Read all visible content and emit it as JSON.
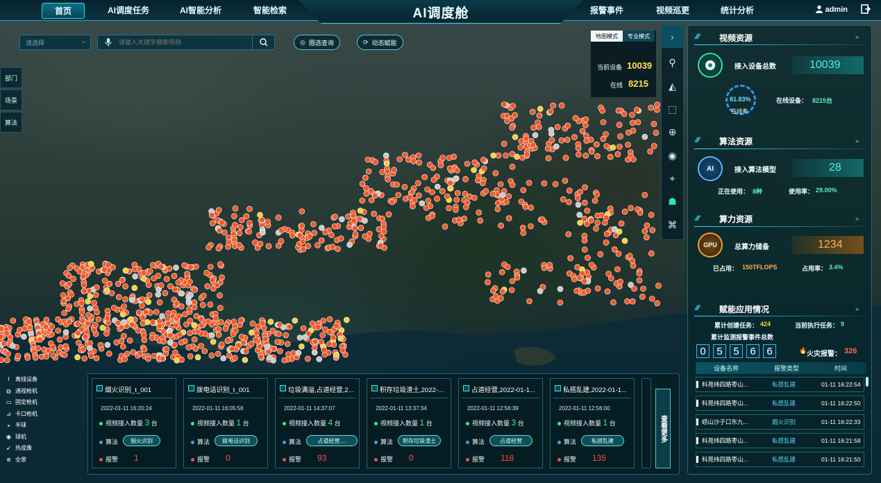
{
  "nav": {
    "home": "首页",
    "ai_task": "AI调度任务",
    "ai_analysis": "AI智能分析",
    "smart_search": "智能检索",
    "title": "AI调度舱",
    "alarm_event": "报警事件",
    "video_patrol": "视频巡更",
    "stats": "统计分析",
    "user": "admin"
  },
  "toolbar": {
    "select_placeholder": "请选择",
    "search_placeholder": "请输入关键字搜索视频",
    "circle_query": "圈选查询",
    "dynamic_assign": "动态赋能"
  },
  "left_nav": [
    "部门",
    "场景",
    "算法"
  ],
  "map_mode": {
    "map": "地图模式",
    "pro": "专业模式",
    "current_devices_label": "当前设备",
    "current_devices": "10039",
    "online_label": "在线",
    "online": "8215"
  },
  "video": {
    "section": "视频资源",
    "total_label": "接入设备总数",
    "total": "10039",
    "rate": "81.83%",
    "rate_label": "在线率",
    "online_label": "在线设备：",
    "online": "8215台"
  },
  "algo": {
    "section": "算法资源",
    "label": "接入算法模型",
    "value": "28",
    "using_label": "正在使用：",
    "using": "8种",
    "use_rate_label": "使用率：",
    "use_rate": "29.00%",
    "icon_text": "AI"
  },
  "compute": {
    "section": "算力资源",
    "label": "总算力储备",
    "value": "1234",
    "used_label": "已占用：",
    "used": "150TFLOPS",
    "occupy_label": "占用率：",
    "occupy": "3.4%",
    "icon_text": "GPU"
  },
  "empower": {
    "section": "赋能应用情况",
    "created_label": "累计创建任务：",
    "created": "424",
    "running_label": "当前执行任务：",
    "running": "9",
    "alarm_total_label": "累计监测报警事件总数",
    "digits": [
      "0",
      "5",
      "5",
      "6",
      "6"
    ],
    "fire_label": "火灾报警：",
    "fire": "326"
  },
  "table": {
    "headers": [
      "设备名称",
      "报警类型",
      "时间"
    ],
    "rows": [
      {
        "name": "科苑纬四路枣山...",
        "type": "私搭乱建",
        "time": "01-11 16:22:54"
      },
      {
        "name": "科苑纬四路枣山...",
        "type": "私搭乱建",
        "time": "01-11 16:22:50"
      },
      {
        "name": "崂山沙子口东九...",
        "type": "烟火识别",
        "time": "01-11 16:22:33"
      },
      {
        "name": "科苑纬四路枣山...",
        "type": "私搭乱建",
        "time": "01-11 16:21:58"
      },
      {
        "name": "科苑纬四路枣山...",
        "type": "私搭乱建",
        "time": "01-11 16:21:50"
      }
    ]
  },
  "legend": [
    "离线设备",
    "通视枪机",
    "固定枪机",
    "卡口枪机",
    "半球",
    "球机",
    "热成像",
    "全景"
  ],
  "cards": [
    {
      "title": "烟火识别_t_001",
      "time": "2022-01-11 16:20:24",
      "qty_label": "视频接入数量",
      "qty": "3",
      "unit": "台",
      "algo_label": "算法",
      "algo": "烟火识别",
      "alarm_label": "报警",
      "alarm": "1"
    },
    {
      "title": "拨电话识别_t_001",
      "time": "2022-01-11 16:05:56",
      "qty_label": "视频接入数量",
      "qty": "1",
      "unit": "台",
      "algo_label": "算法",
      "algo": "拨电话识别",
      "alarm_label": "报警",
      "alarm": "0"
    },
    {
      "title": "垃圾满溢,占道经营,2...",
      "time": "2022-01-11 14:37:07",
      "qty_label": "视频接入数量",
      "qty": "4",
      "unit": "台",
      "algo_label": "算法",
      "algo": "占道经营,...",
      "alarm_label": "报警",
      "alarm": "93"
    },
    {
      "title": "积存垃圾渣土,2022-...",
      "time": "2022-01-11 13:37:34",
      "qty_label": "视频接入数量",
      "qty": "1",
      "unit": "台",
      "algo_label": "算法",
      "algo": "积存垃圾渣土",
      "alarm_label": "报警",
      "alarm": "0"
    },
    {
      "title": "占道经营,2022-01-1...",
      "time": "2022-01-11 12:56:39",
      "qty_label": "视频接入数量",
      "qty": "3",
      "unit": "台",
      "algo_label": "算法",
      "algo": "占道经营",
      "alarm_label": "报警",
      "alarm": "118"
    },
    {
      "title": "私搭乱建,2022-01-1...",
      "time": "2022-01-11 12:56:00",
      "qty_label": "视频接入数量",
      "qty": "1",
      "unit": "台",
      "algo_label": "算法",
      "algo": "私搭乱建",
      "alarm_label": "报警",
      "alarm": "135"
    }
  ],
  "more": "查看更多",
  "colors": {
    "accent": "#2fe6ff",
    "marker": "#f05a2a",
    "alarm_red": "#ff4b4b",
    "value_green": "#51f0d4"
  }
}
